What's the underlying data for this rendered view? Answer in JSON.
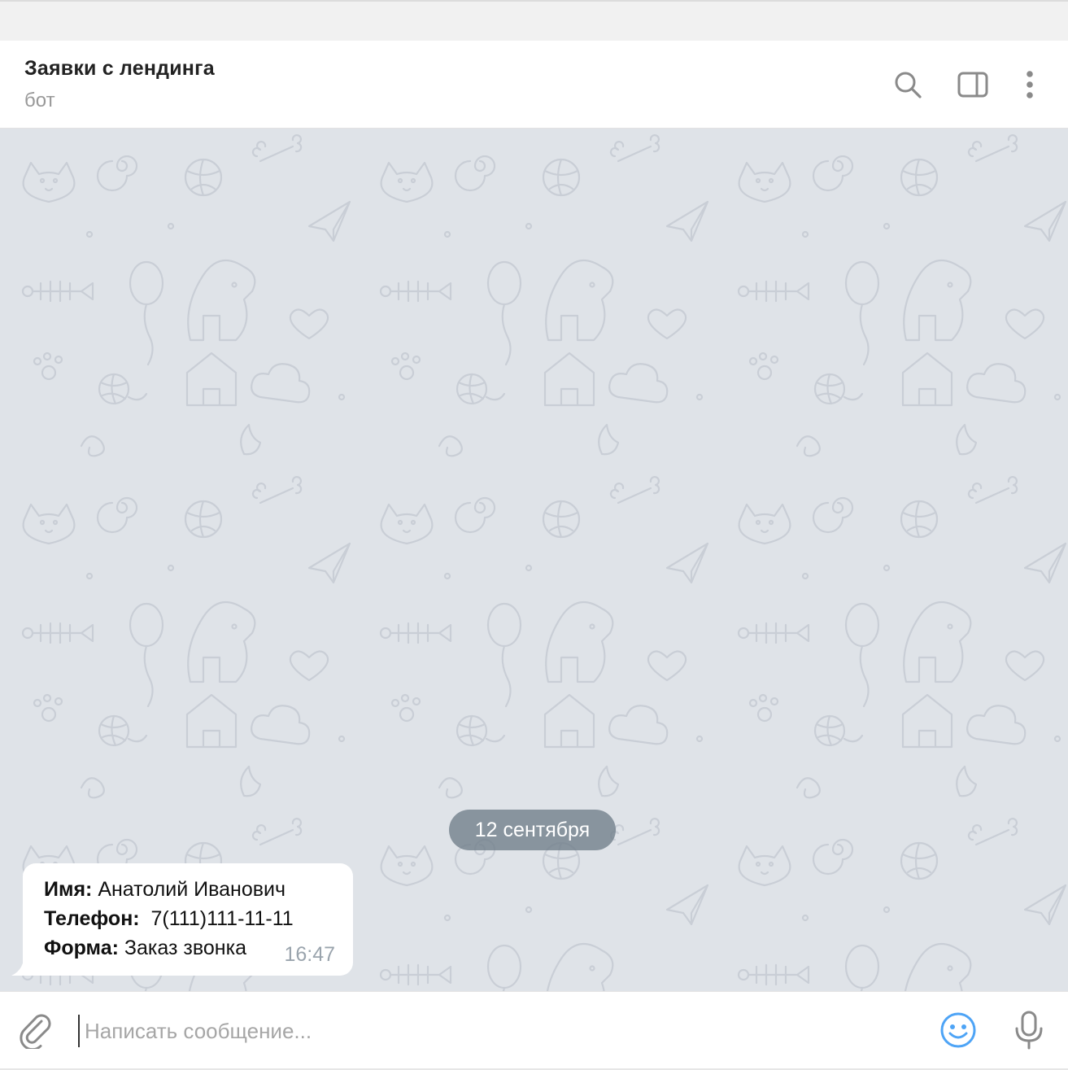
{
  "header": {
    "title": "Заявки с лендинга",
    "subtitle": "бот",
    "icons": [
      "search-icon",
      "sidebar-toggle-icon",
      "more-vertical-icon"
    ]
  },
  "chat": {
    "date_separator": "12 сентября",
    "message": {
      "name_label": "Имя:",
      "name_value": " Анатолий Иванович",
      "phone_label": "Телефон:",
      "phone_value": "  7(111)111-11-11",
      "form_label": "Форма:",
      "form_value": " Заказ звонка",
      "time": "16:47"
    }
  },
  "composer": {
    "placeholder": "Написать сообщение...",
    "icons": [
      "paperclip-icon",
      "emoji-icon",
      "microphone-icon"
    ]
  },
  "colors": {
    "background": "#dfe3e8",
    "accent": "#4ea4f6",
    "date_pill": "#707d89",
    "icon_gray": "#8a8a8a"
  }
}
